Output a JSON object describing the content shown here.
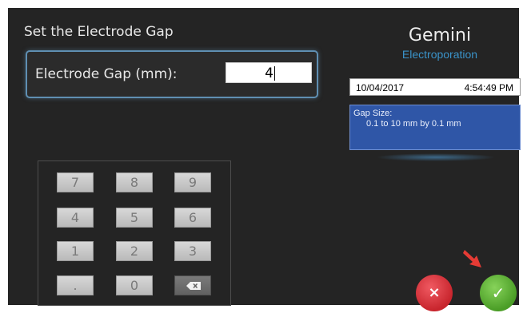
{
  "screen": {
    "title": "Set the Electrode Gap",
    "gap_field": {
      "label": "Electrode Gap (mm):",
      "value": "4"
    },
    "brand": {
      "name": "Gemini",
      "subtitle": "Electroporation"
    },
    "datetime": {
      "date": "10/04/2017",
      "time": "4:54:49 PM"
    },
    "info": {
      "line1": "Gap Size:",
      "line2": "0.1 to 10 mm by 0.1 mm"
    },
    "keypad": {
      "keys": [
        "7",
        "8",
        "9",
        "4",
        "5",
        "6",
        "1",
        "2",
        "3",
        ".",
        "0"
      ],
      "backspace_icon": "backspace-icon"
    },
    "buttons": {
      "cancel_label": "×",
      "ok_label": "✓"
    },
    "colors": {
      "background": "#242424",
      "accent_blue": "#3a93c9",
      "info_bg": "#2f56a7",
      "cancel_red": "#c8252d",
      "ok_green": "#4a9d26",
      "pointer_red": "#e53b35"
    },
    "pointer_icon": "arrow-pointer-icon"
  }
}
